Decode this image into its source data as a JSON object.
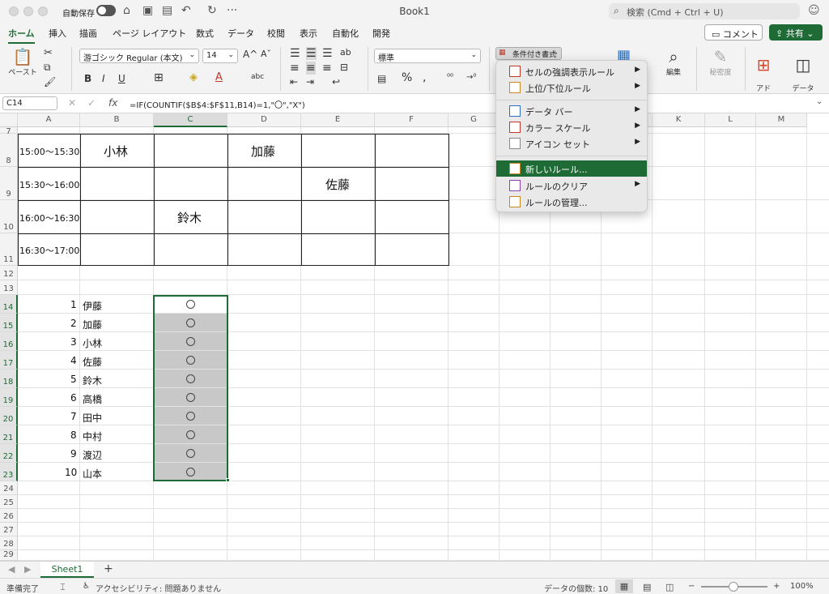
{
  "titlebar": {
    "autosave": "自動保存",
    "title": "Book1",
    "search_placeholder": "検索 (Cmd + Ctrl + U)"
  },
  "tabs": [
    "ホーム",
    "挿入",
    "描画",
    "ページ レイアウト",
    "数式",
    "データ",
    "校閲",
    "表示",
    "自動化",
    "開発"
  ],
  "buttons": {
    "comment": "コメント",
    "share": "共有"
  },
  "ribbon": {
    "paste": "ペースト",
    "font_name": "游ゴシック Regular (本文)",
    "font_size": "14",
    "number_format": "標準",
    "conditional_format": "条件付き書式",
    "editing": "編集",
    "sensitivity": "秘密度",
    "addins": "アド\nイン",
    "analysis": "データ\nの分析"
  },
  "formula_bar": {
    "cell": "C14",
    "formula": "=IF(COUNTIF($B$4:$F$11,B14)=1,\"〇\",\"X\")"
  },
  "columns": [
    "A",
    "B",
    "C",
    "D",
    "E",
    "F",
    "G",
    "H",
    "I",
    "J",
    "K",
    "L",
    "M"
  ],
  "rows": [
    "7",
    "8",
    "9",
    "10",
    "11",
    "12",
    "13",
    "14",
    "15",
    "16",
    "17",
    "18",
    "19",
    "20",
    "21",
    "22",
    "23",
    "24",
    "25",
    "26",
    "27",
    "28",
    "29"
  ],
  "schedule": {
    "times": [
      "15:00〜15:30",
      "15:30〜16:00",
      "16:00〜16:30",
      "16:30〜17:00"
    ],
    "names": {
      "r8_b": "小林",
      "r8_d": "加藤",
      "r9_e": "佐藤",
      "r10_c": "鈴木"
    }
  },
  "list": {
    "numbers": [
      "1",
      "2",
      "3",
      "4",
      "5",
      "6",
      "7",
      "8",
      "9",
      "10"
    ],
    "names": [
      "伊藤",
      "加藤",
      "小林",
      "佐藤",
      "鈴木",
      "高橋",
      "田中",
      "中村",
      "渡辺",
      "山本"
    ]
  },
  "menu": {
    "items": [
      "セルの強調表示ルール",
      "上位/下位ルール",
      "データ バー",
      "カラー スケール",
      "アイコン セット",
      "新しいルール...",
      "ルールのクリア",
      "ルールの管理..."
    ]
  },
  "sheet": {
    "name": "Sheet1"
  },
  "status": {
    "ready": "準備完了",
    "accessibility": "アクセシビリティ: 問題ありません",
    "count": "データの個数: 10",
    "zoom": "100%"
  },
  "colors": {
    "accent": "#1e6b36",
    "selection_fill": "#c8c8c8"
  }
}
